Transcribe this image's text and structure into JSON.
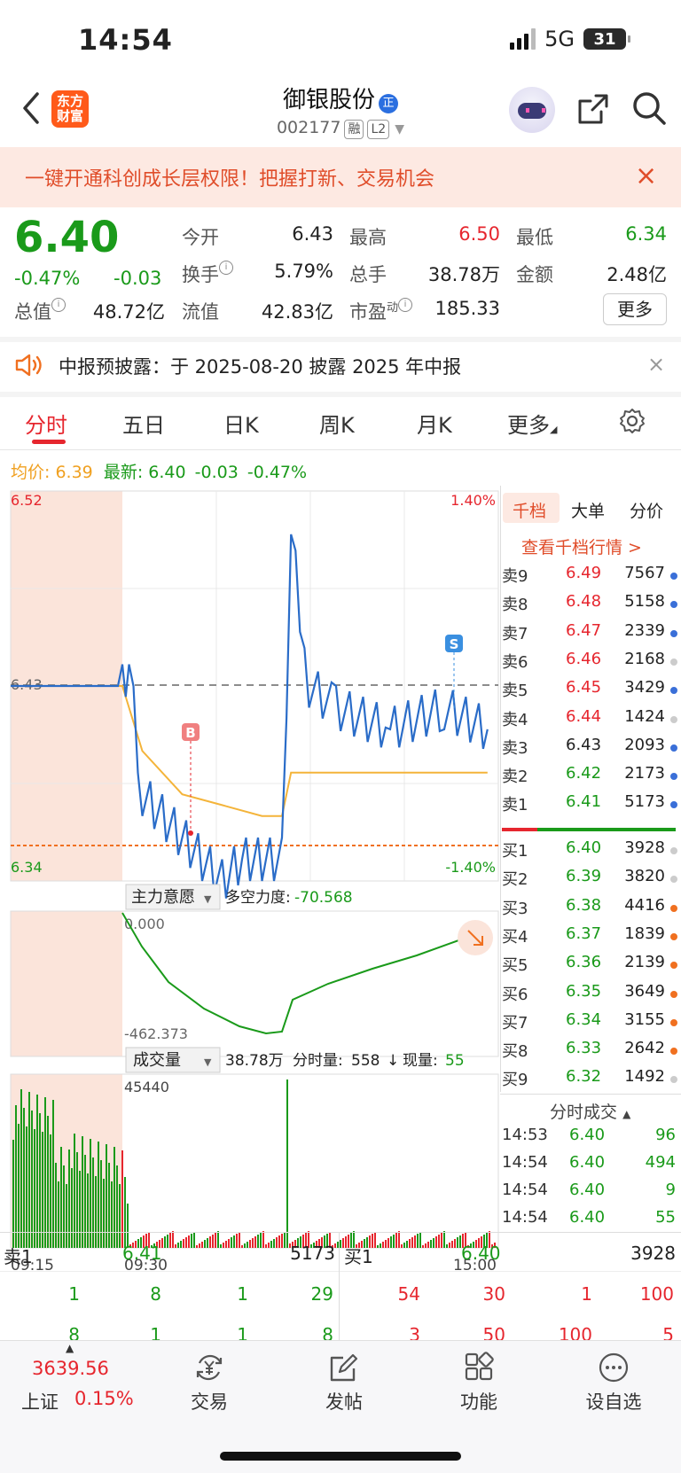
{
  "status": {
    "time": "14:54",
    "network": "5G",
    "battery": "31"
  },
  "header": {
    "logo_line1": "东方",
    "logo_line2": "财富",
    "stock_name": "御银股份",
    "badge": "正",
    "code": "002177",
    "tag1": "融",
    "tag2": "L2"
  },
  "banner": {
    "text": "一键开通科创成长层权限！把握打新、交易机会",
    "close": "×"
  },
  "quote": {
    "price": "6.40",
    "pct": "-0.47%",
    "chg": "-0.03",
    "open_label": "今开",
    "open": "6.43",
    "high_label": "最高",
    "high": "6.50",
    "low_label": "最低",
    "low": "6.34",
    "turnover_label": "换手",
    "turnover": "5.79%",
    "volume_label": "总手",
    "volume": "38.78万",
    "amount_label": "金额",
    "amount": "2.48亿",
    "mktcap_label": "总值",
    "mktcap": "48.72亿",
    "float_label": "流值",
    "float": "42.83亿",
    "pe_label": "市盈",
    "pe_sup": "动",
    "pe": "185.33",
    "more": "更多"
  },
  "notice": {
    "text": "中报预披露：于 2025-08-20 披露 2025 年中报",
    "close": "×"
  },
  "tabs": [
    "分时",
    "五日",
    "日K",
    "周K",
    "月K",
    "更多"
  ],
  "avg_line": {
    "avg_label": "均价:",
    "avg": "6.39",
    "last_label": "最新:",
    "last": "6.40",
    "chg": "-0.03",
    "pct": "-0.47%"
  },
  "price_axis": {
    "top": "6.52",
    "mid": "6.43",
    "bottom": "6.34",
    "top_pct": "1.40%",
    "bottom_pct": "-1.40%"
  },
  "markers": {
    "buy": "B",
    "sell": "S"
  },
  "indicator": {
    "select_label": "主力意愿",
    "power_label": "多空力度:",
    "power_value": "-70.568",
    "top": "0.000",
    "bottom": "-462.373"
  },
  "volume_panel": {
    "select_label": "成交量",
    "total": "38.78万",
    "bar_label": "分时量:",
    "bar_value": "558",
    "arrow": "↓",
    "now_label": "现量:",
    "now_value": "55",
    "max": "45440"
  },
  "time_axis": [
    "09:15",
    "09:30",
    "15:00"
  ],
  "orderbook": {
    "tabs": [
      "千档",
      "大单",
      "分价"
    ],
    "link": "查看千档行情 >",
    "asks": [
      {
        "label": "卖9",
        "price": "6.49",
        "vol": "7567",
        "dot": "#3a6fd8"
      },
      {
        "label": "卖8",
        "price": "6.48",
        "vol": "5158",
        "dot": "#3a6fd8"
      },
      {
        "label": "卖7",
        "price": "6.47",
        "vol": "2339",
        "dot": "#3a6fd8"
      },
      {
        "label": "卖6",
        "price": "6.46",
        "vol": "2168",
        "dot": "#cccccc"
      },
      {
        "label": "卖5",
        "price": "6.45",
        "vol": "3429",
        "dot": "#3a6fd8"
      },
      {
        "label": "卖4",
        "price": "6.44",
        "vol": "1424",
        "dot": "#cccccc"
      },
      {
        "label": "卖3",
        "price": "6.43",
        "vol": "2093",
        "dot": "#3a6fd8"
      },
      {
        "label": "卖2",
        "price": "6.42",
        "vol": "2173",
        "dot": "#3a6fd8"
      },
      {
        "label": "卖1",
        "price": "6.41",
        "vol": "5173",
        "dot": "#3a6fd8"
      }
    ],
    "bids": [
      {
        "label": "买1",
        "price": "6.40",
        "vol": "3928",
        "dot": "#cccccc"
      },
      {
        "label": "买2",
        "price": "6.39",
        "vol": "3820",
        "dot": "#cccccc"
      },
      {
        "label": "买3",
        "price": "6.38",
        "vol": "4416",
        "dot": "#f07020"
      },
      {
        "label": "买4",
        "price": "6.37",
        "vol": "1839",
        "dot": "#f07020"
      },
      {
        "label": "买5",
        "price": "6.36",
        "vol": "2139",
        "dot": "#f07020"
      },
      {
        "label": "买6",
        "price": "6.35",
        "vol": "3649",
        "dot": "#f07020"
      },
      {
        "label": "买7",
        "price": "6.34",
        "vol": "3155",
        "dot": "#f07020"
      },
      {
        "label": "买8",
        "price": "6.33",
        "vol": "2642",
        "dot": "#f07020"
      },
      {
        "label": "买9",
        "price": "6.32",
        "vol": "1492",
        "dot": "#cccccc"
      }
    ],
    "trades_title": "分时成交",
    "trades": [
      {
        "time": "14:53",
        "price": "6.40",
        "vol": "96"
      },
      {
        "time": "14:54",
        "price": "6.40",
        "vol": "494"
      },
      {
        "time": "14:54",
        "price": "6.40",
        "vol": "9"
      },
      {
        "time": "14:54",
        "price": "6.40",
        "vol": "55"
      }
    ]
  },
  "queue": {
    "ask_label": "卖1",
    "ask_price": "6.41",
    "ask_vol": "5173",
    "bid_label": "买1",
    "bid_price": "6.40",
    "bid_vol": "3928",
    "ask_row1": [
      "1",
      "8",
      "1",
      "29"
    ],
    "ask_row2": [
      "8",
      "1",
      "1",
      "8"
    ],
    "bid_row1": [
      "54",
      "30",
      "1",
      "100"
    ],
    "bid_row2": [
      "3",
      "50",
      "100",
      "5"
    ]
  },
  "bottom_nav": {
    "index_value": "3639.56",
    "index_name": "上证",
    "index_pct": "0.15%",
    "items": [
      "交易",
      "发帖",
      "功能",
      "设自选"
    ]
  },
  "chart_data": {
    "type": "line",
    "title": "",
    "ylim": [
      6.34,
      6.52
    ],
    "series": [
      {
        "name": "最新",
        "x": [
          "09:15",
          "09:30",
          "09:35",
          "09:45",
          "10:00",
          "10:15",
          "10:30",
          "10:45",
          "11:00",
          "11:15",
          "11:30",
          "13:05",
          "13:15",
          "13:30",
          "14:00",
          "14:30",
          "14:54"
        ],
        "values": [
          6.43,
          6.43,
          6.44,
          6.38,
          6.37,
          6.36,
          6.35,
          6.34,
          6.35,
          6.35,
          6.35,
          6.5,
          6.43,
          6.42,
          6.41,
          6.42,
          6.41
        ]
      },
      {
        "name": "均价",
        "x": [
          "09:15",
          "09:30",
          "09:45",
          "10:15",
          "10:45",
          "11:15",
          "11:30",
          "13:05",
          "13:30",
          "14:00",
          "14:54"
        ],
        "values": [
          6.43,
          6.43,
          6.4,
          6.38,
          6.375,
          6.37,
          6.37,
          6.39,
          6.39,
          6.39,
          6.39
        ]
      }
    ]
  }
}
